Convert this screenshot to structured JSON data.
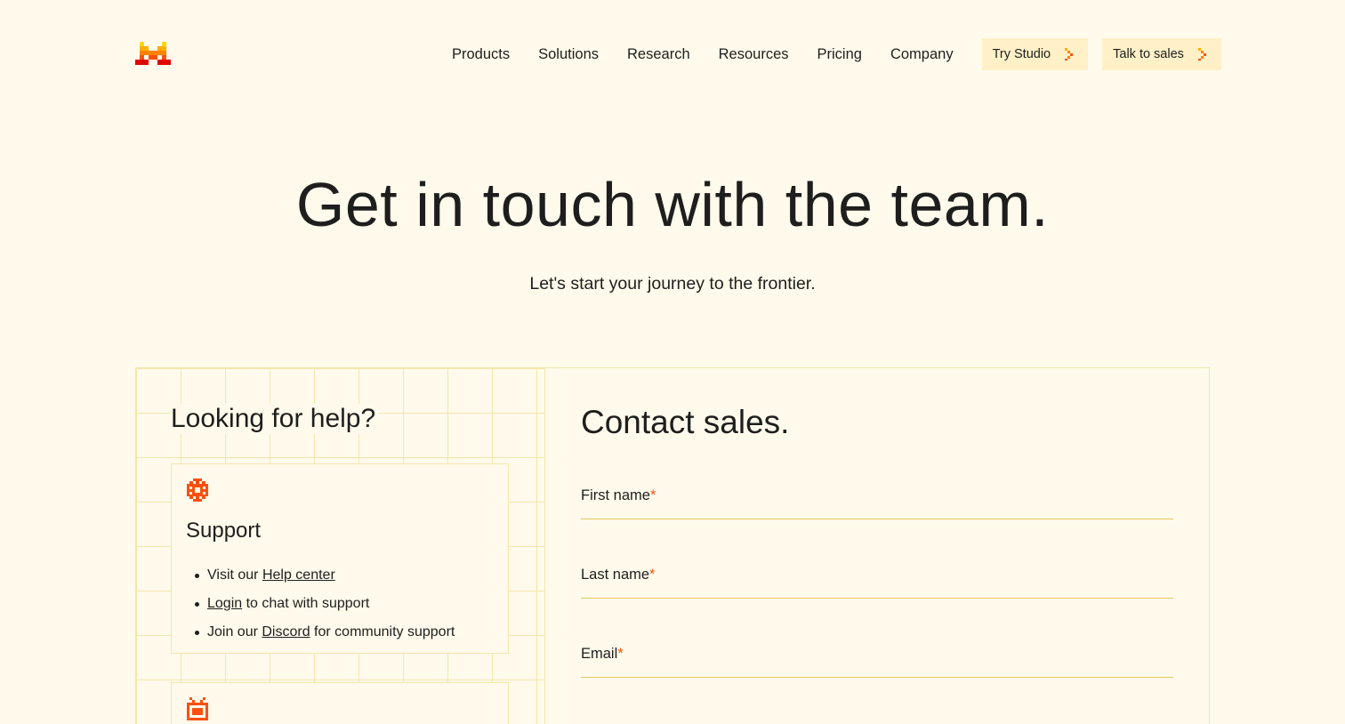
{
  "nav": {
    "items": [
      "Products",
      "Solutions",
      "Research",
      "Resources",
      "Pricing",
      "Company"
    ],
    "try_studio": "Try Studio",
    "talk_to_sales": "Talk to sales"
  },
  "hero": {
    "title": "Get in touch with the team.",
    "subtitle": "Let's start your journey to the frontier."
  },
  "help": {
    "title": "Looking for help?",
    "support_card": {
      "title": "Support",
      "item1_prefix": "Visit our ",
      "item1_link": "Help center",
      "item2_link": "Login",
      "item2_suffix": " to chat with support",
      "item3_prefix": "Join our ",
      "item3_link": "Discord",
      "item3_suffix": " for community support"
    }
  },
  "contact": {
    "title": "Contact sales.",
    "fields": [
      {
        "label": "First name",
        "required_mark": "*"
      },
      {
        "label": "Last name",
        "required_mark": "*"
      },
      {
        "label": "Email",
        "required_mark": "*"
      }
    ]
  },
  "colors": {
    "background": "#fffaeb",
    "accent": "#fa520f",
    "cta_bg": "#fff0c7",
    "grid_line": "#f5e6ad"
  }
}
